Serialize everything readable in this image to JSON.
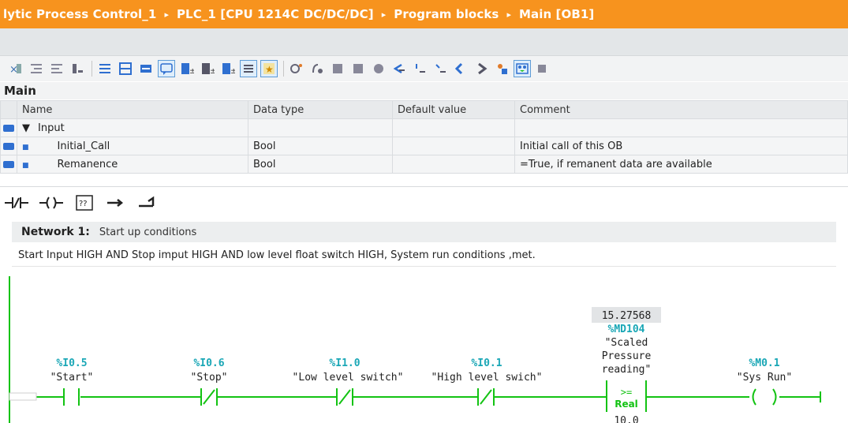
{
  "breadcrumb": {
    "items": [
      "lytic Process Control_1",
      "PLC_1 [CPU 1214C DC/DC/DC]",
      "Program blocks",
      "Main [OB1]"
    ],
    "separator": "▸"
  },
  "toolbar": {
    "icons": [
      "insert-row-icon",
      "indent-icon",
      "outdent-icon",
      "network-icon",
      "list-icon",
      "grid-icon",
      "absolute-operands-icon",
      "comment-icon",
      "open-all-icon",
      "close-all-icon",
      "expand-icon",
      "list-view-icon",
      "favorites-icon",
      "go-online-icon",
      "monitor-icon",
      "step-icon",
      "breakpoint-icon",
      "watch-icon",
      "call-icon",
      "step-over-icon",
      "step-out-icon",
      "jump-icon",
      "refresh-icon",
      "user-icon",
      "monitoring-on-icon",
      "more-icon"
    ]
  },
  "block": {
    "name": "Main"
  },
  "interface_table": {
    "headers": [
      "Name",
      "Data type",
      "Default value",
      "Comment"
    ],
    "rows": [
      {
        "name": "Input",
        "type": "",
        "default": "",
        "comment": "",
        "expander": "▼"
      },
      {
        "name": "Initial_Call",
        "type": "Bool",
        "default": "",
        "comment": "Initial call of this OB",
        "expander": "■"
      },
      {
        "name": "Remanence",
        "type": "Bool",
        "default": "",
        "comment": "=True, if remanent data are available",
        "expander": "■"
      }
    ]
  },
  "ladder_tools": [
    "nc-contact-icon",
    "coil-icon",
    "empty-box-icon",
    "open-branch-icon",
    "close-branch-icon"
  ],
  "ladder_tools_labels": {
    "box": "??"
  },
  "network": {
    "title": "Network 1:",
    "subtitle": "Start up conditions",
    "comment": "Start Input HIGH AND Stop imput HIGH AND low level float switch HIGH, System run conditions ,met."
  },
  "ladder": {
    "contacts": [
      {
        "address": "%I0.5",
        "symbol": "\"Start\"",
        "type": "NO"
      },
      {
        "address": "%I0.6",
        "symbol": "\"Stop\"",
        "type": "NC"
      },
      {
        "address": "%I1.0",
        "symbol": "\"Low level switch\"",
        "type": "NC"
      },
      {
        "address": "%I0.1",
        "symbol": "\"High level swich\"",
        "type": "NC"
      }
    ],
    "compare": {
      "value": "15.27568",
      "address": "%MD104",
      "symbol_lines": [
        "\"Scaled",
        "Pressure",
        "reading\""
      ],
      "op": ">=",
      "type": "Real",
      "operand2": "10.0"
    },
    "coil": {
      "address": "%M0.1",
      "symbol": "\"Sys Run\""
    },
    "colors": {
      "energized": "#13c313",
      "operand": "#1aa7b6",
      "title": "#f7931e"
    }
  }
}
